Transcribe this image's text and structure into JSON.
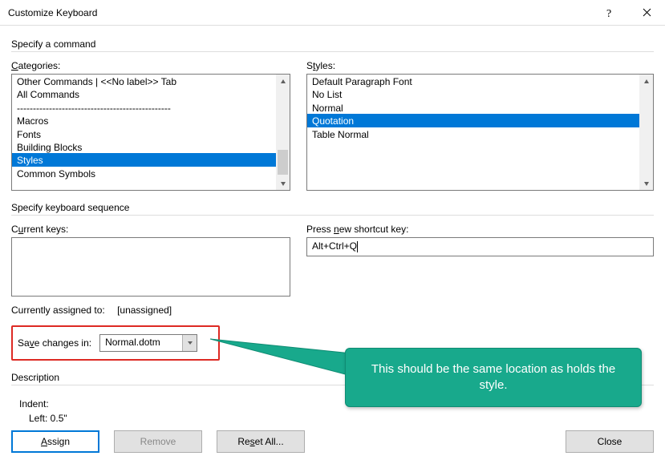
{
  "window": {
    "title": "Customize Keyboard"
  },
  "sections": {
    "specify_command": "Specify a command",
    "specify_sequence": "Specify keyboard sequence",
    "description": "Description"
  },
  "labels": {
    "categories": "Categories:",
    "styles": "Styles:",
    "current_keys": "Current keys:",
    "press_new": "Press new shortcut key:",
    "currently_assigned_to": "Currently assigned to:",
    "save_changes_in": "Save changes in:",
    "indent": "Indent:",
    "left": "Left:  0.5\""
  },
  "categories": {
    "items": [
      "Other Commands | <<No label>> Tab",
      "All Commands",
      "------------------------------------------------",
      "Macros",
      "Fonts",
      "Building Blocks",
      "Styles",
      "Common Symbols"
    ],
    "selected_index": 6
  },
  "styles": {
    "items": [
      "Default Paragraph Font",
      "No List",
      "Normal",
      "Quotation",
      "Table Normal"
    ],
    "selected_index": 3
  },
  "current_keys": [],
  "new_shortcut": "Alt+Ctrl+Q",
  "currently_assigned_value": "[unassigned]",
  "save_changes": {
    "value": "Normal.dotm"
  },
  "buttons": {
    "assign": "Assign",
    "remove": "Remove",
    "reset": "Reset All...",
    "close": "Close"
  },
  "callout": "This should be the same location as holds the style."
}
